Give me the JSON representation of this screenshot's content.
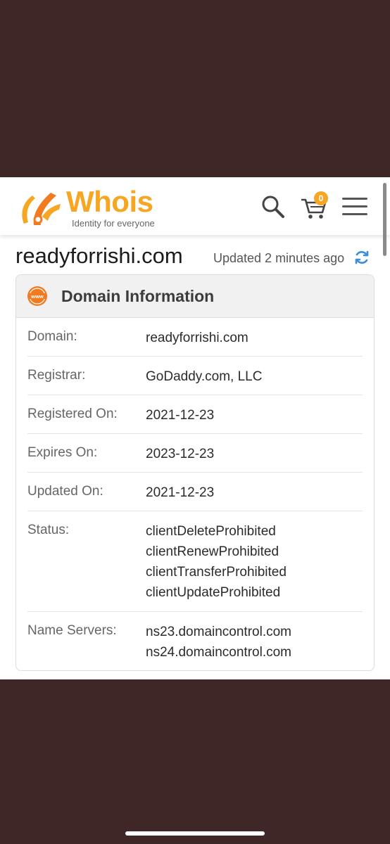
{
  "brand": {
    "name": "Whois",
    "tagline": "Identity for everyone",
    "color": "#f6a623"
  },
  "header": {
    "cart_count": "0",
    "icons": [
      "search-icon",
      "cart-icon",
      "menu-icon"
    ]
  },
  "page": {
    "domain_title": "readyforrishi.com",
    "updated_text": "Updated 2 minutes ago"
  },
  "card": {
    "title": "Domain Information",
    "rows": [
      {
        "label": "Domain:",
        "values": [
          "readyforrishi.com"
        ]
      },
      {
        "label": "Registrar:",
        "values": [
          "GoDaddy.com, LLC"
        ]
      },
      {
        "label": "Registered On:",
        "values": [
          "2021-12-23"
        ]
      },
      {
        "label": "Expires On:",
        "values": [
          "2023-12-23"
        ]
      },
      {
        "label": "Updated On:",
        "values": [
          "2021-12-23"
        ]
      },
      {
        "label": "Status:",
        "values": [
          "clientDeleteProhibited",
          "clientRenewProhibited",
          "clientTransferProhibited",
          "clientUpdateProhibited"
        ]
      },
      {
        "label": "Name Servers:",
        "values": [
          "ns23.domaincontrol.com",
          "ns24.domaincontrol.com"
        ]
      }
    ]
  }
}
